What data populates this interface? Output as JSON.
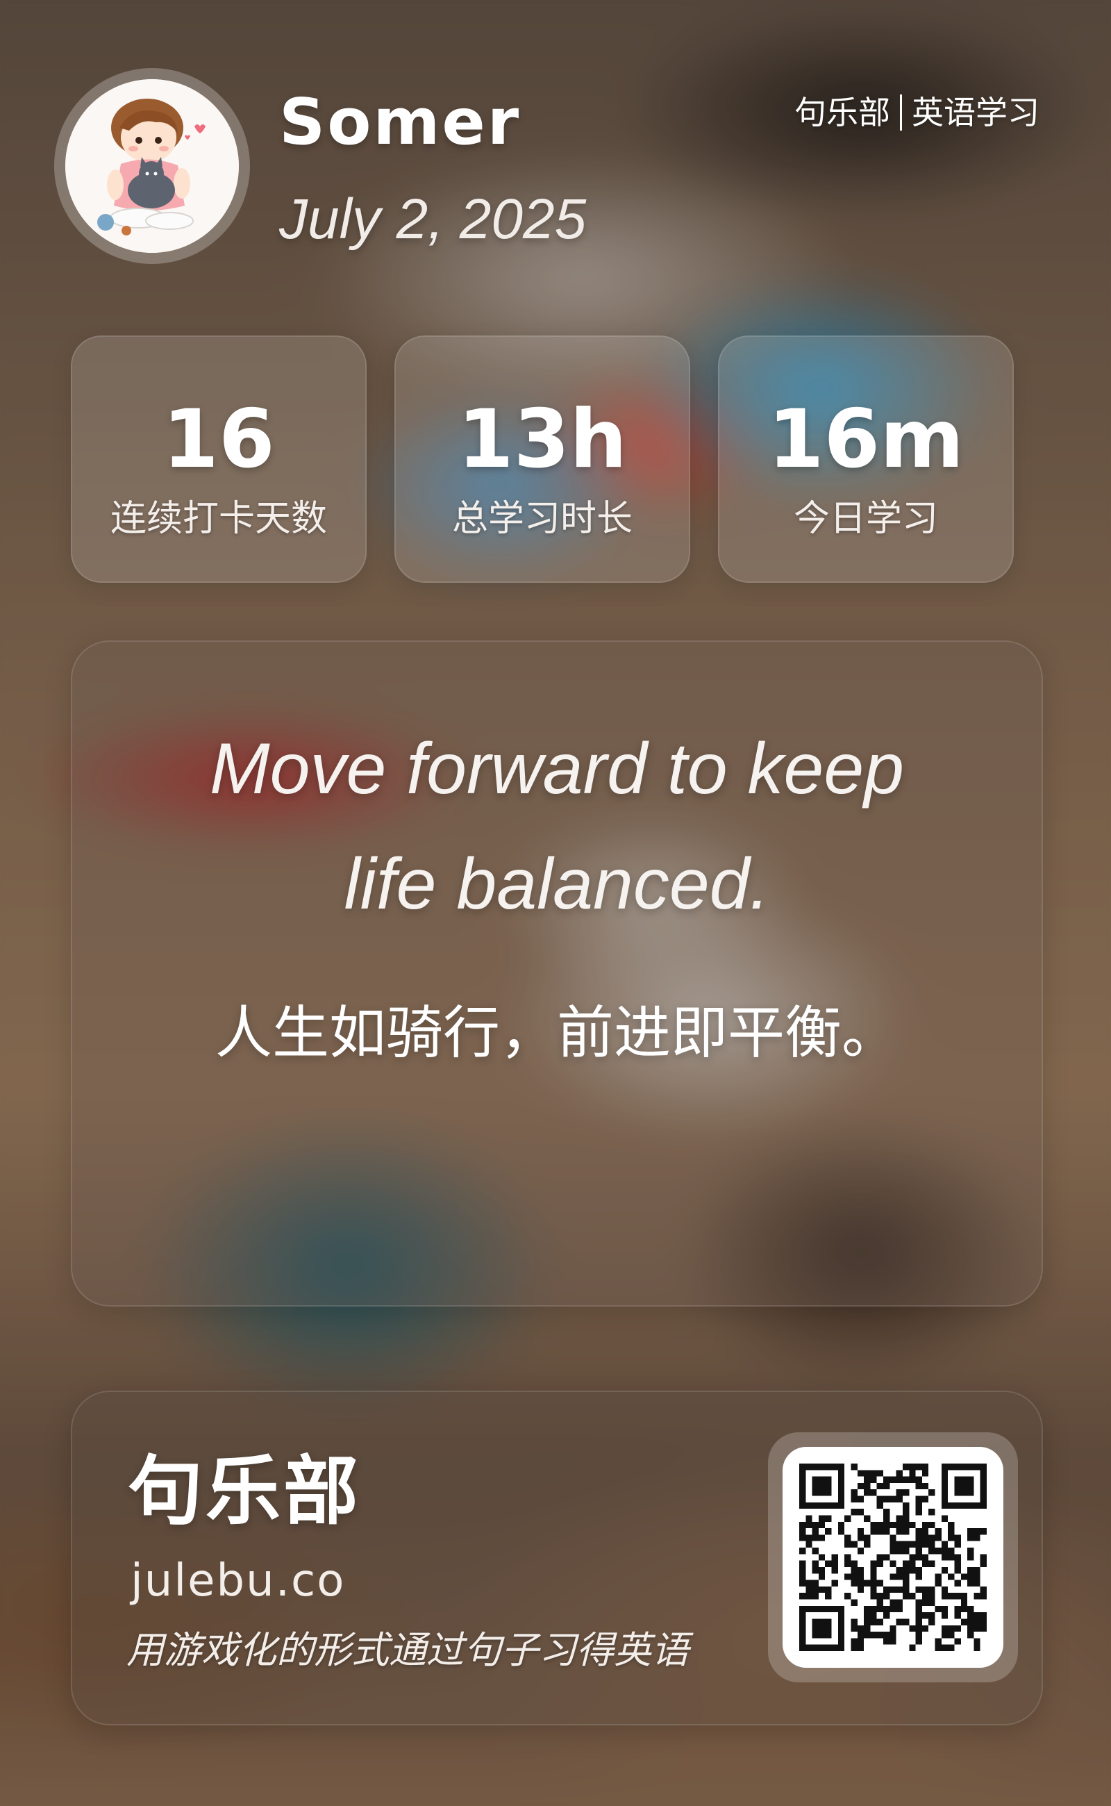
{
  "header": {
    "username": "Somer",
    "date": "July 2, 2025",
    "brand_name": "句乐部",
    "brand_section": "英语学习"
  },
  "stats": [
    {
      "value": "16",
      "label": "连续打卡天数"
    },
    {
      "value": "13h",
      "label": "总学习时长"
    },
    {
      "value": "16m",
      "label": "今日学习"
    }
  ],
  "quote": {
    "english_line1": "Move forward to keep",
    "english_line2": "life balanced.",
    "chinese": "人生如骑行，前进即平衡。"
  },
  "footer": {
    "title": "句乐部",
    "url": "julebu.co",
    "slogan": "用游戏化的形式通过句子习得英语"
  },
  "icons": {
    "avatar": "cartoon-boy-with-cat-avatar",
    "qr": "qr-code-icon"
  }
}
